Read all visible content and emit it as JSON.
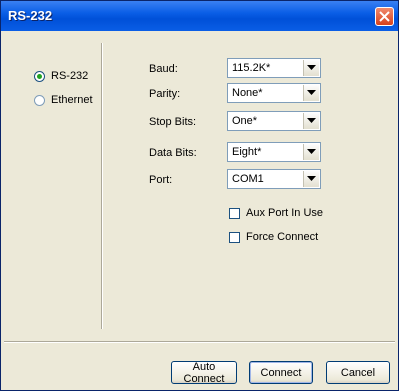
{
  "window": {
    "title": "RS-232"
  },
  "connection": {
    "options": [
      {
        "label": "RS-232",
        "selected": true
      },
      {
        "label": "Ethernet",
        "selected": false
      }
    ]
  },
  "settings": {
    "baud": {
      "label": "Baud:",
      "value": "115.2K*"
    },
    "parity": {
      "label": "Parity:",
      "value": "None*"
    },
    "stop_bits": {
      "label": "Stop Bits:",
      "value": "One*"
    },
    "data_bits": {
      "label": "Data Bits:",
      "value": "Eight*"
    },
    "port": {
      "label": "Port:",
      "value": "COM1"
    }
  },
  "checkboxes": {
    "aux_port": {
      "label": "Aux Port In Use",
      "checked": false
    },
    "force_connect": {
      "label": "Force Connect",
      "checked": false
    }
  },
  "buttons": {
    "auto_connect": "Auto Connect",
    "connect": "Connect",
    "cancel": "Cancel"
  },
  "colors": {
    "title_bar": "#0a5ee6",
    "dialog_bg": "#ece9d8",
    "close_button": "#d8411c"
  }
}
